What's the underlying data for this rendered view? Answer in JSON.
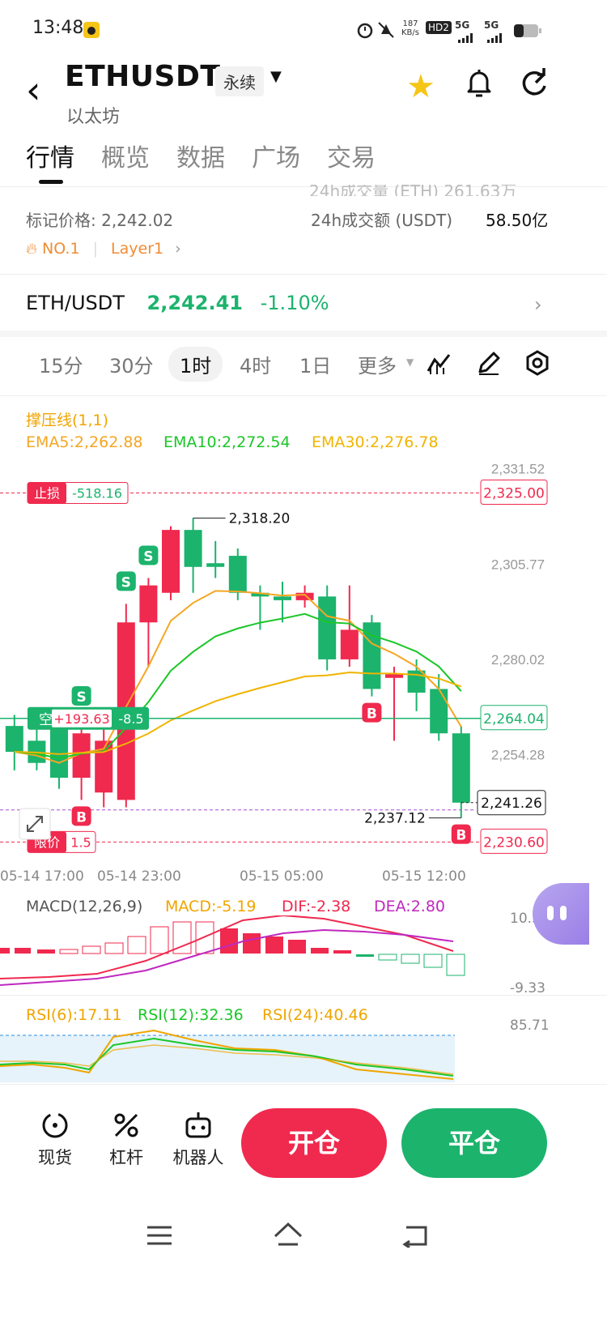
{
  "status_bar": {
    "time": "13:48",
    "net_speed_top": "187",
    "net_speed_bottom": "KB/s",
    "hd": "HD2",
    "sig1": "5G",
    "sig2": "5G"
  },
  "header": {
    "symbol": "ETHUSDT",
    "contract": "永续",
    "name": "以太坊"
  },
  "tabs": [
    "行情",
    "概览",
    "数据",
    "广场",
    "交易"
  ],
  "stats": {
    "mark_price": "标记价格: 2,242.02",
    "turnover_label": "24h成交额 (USDT)",
    "turnover_value": "58.50亿",
    "partial_row": "24h成交量 (ETH)  261.63万"
  },
  "tags": {
    "rank": "NO.1",
    "category": "Layer1"
  },
  "pair": {
    "name": "ETH/USDT",
    "price": "2,242.41",
    "change": "-1.10%"
  },
  "timeframes": [
    "15分",
    "30分",
    "1时",
    "4时",
    "1日",
    "更多"
  ],
  "selected_timeframe": "1时",
  "colors": {
    "up": "#1cb36d",
    "down": "#f0294e",
    "ema5": "#f5a623",
    "ema10": "#1bc628",
    "ema30": "#f0b400",
    "accent": "#f0294e"
  },
  "chart_data": {
    "type": "candlestick",
    "indicator_label": "撑压线(1,1)",
    "ema": {
      "ema5": "EMA5:2,262.88",
      "ema10": "EMA10:2,272.54",
      "ema30": "EMA30:2,276.78"
    },
    "y_ticks": [
      "2,331.52",
      "2,305.77",
      "2,280.02",
      "2,254.28"
    ],
    "x_ticks": [
      "05-14 17:00",
      "05-14 23:00",
      "05-15 05:00",
      "05-15 12:00"
    ],
    "ylim": [
      2225,
      2340
    ],
    "high_label": "2,318.20",
    "low_label": "2,237.12",
    "stop_loss": {
      "label": "止损",
      "pnl": "-518.16",
      "price": "2,325.00",
      "value": 2325
    },
    "position": {
      "label": "空",
      "pnl": "+193.63",
      "qty": "-8.5",
      "price": "2,264.04",
      "value": 2264.04
    },
    "limit": {
      "label": "限价",
      "qty": "1.5",
      "price": "2,230.60",
      "value": 2230.6
    },
    "last_price": {
      "price": "2,241.26",
      "value": 2241.26
    },
    "candles": [
      {
        "o": 2262,
        "c": 2255,
        "h": 2265,
        "l": 2250
      },
      {
        "o": 2258,
        "c": 2252,
        "h": 2262,
        "l": 2250
      },
      {
        "o": 2262,
        "c": 2248,
        "h": 2266,
        "l": 2245
      },
      {
        "o": 2248,
        "c": 2260,
        "h": 2264,
        "l": 2242
      },
      {
        "o": 2244,
        "c": 2258,
        "h": 2262,
        "l": 2240
      },
      {
        "o": 2242,
        "c": 2290,
        "h": 2295,
        "l": 2240
      },
      {
        "o": 2290,
        "c": 2300,
        "h": 2302,
        "l": 2278
      },
      {
        "o": 2298,
        "c": 2315,
        "h": 2316,
        "l": 2296
      },
      {
        "o": 2315,
        "c": 2305,
        "h": 2318.2,
        "l": 2298
      },
      {
        "o": 2306,
        "c": 2305,
        "h": 2312,
        "l": 2302
      },
      {
        "o": 2308,
        "c": 2298,
        "h": 2310,
        "l": 2296
      },
      {
        "o": 2298,
        "c": 2297,
        "h": 2300,
        "l": 2288
      },
      {
        "o": 2297,
        "c": 2296,
        "h": 2301,
        "l": 2290
      },
      {
        "o": 2296,
        "c": 2298,
        "h": 2300,
        "l": 2294
      },
      {
        "o": 2297,
        "c": 2280,
        "h": 2300,
        "l": 2277
      },
      {
        "o": 2280,
        "c": 2288,
        "h": 2300,
        "l": 2278
      },
      {
        "o": 2290,
        "c": 2272,
        "h": 2292,
        "l": 2270
      },
      {
        "o": 2275,
        "c": 2276,
        "h": 2278,
        "l": 2258
      },
      {
        "o": 2277,
        "c": 2271,
        "h": 2280,
        "l": 2266
      },
      {
        "o": 2272,
        "c": 2260,
        "h": 2276,
        "l": 2258
      },
      {
        "o": 2260,
        "c": 2241.26,
        "h": 2262,
        "l": 2237.12
      }
    ],
    "macd": {
      "label": "MACD(12,26,9)",
      "macd": "MACD:-5.19",
      "dif": "DIF:-2.38",
      "dea": "DEA:2.80",
      "ytop": "10.31",
      "ybot": "-9.33"
    },
    "rsi": {
      "rsi6": "RSI(6):17.11",
      "rsi12": "RSI(12):32.36",
      "rsi24": "RSI(24):40.46",
      "ytop": "85.71"
    },
    "markers": [
      {
        "type": "S",
        "index": 6
      },
      {
        "type": "S",
        "index": 5
      },
      {
        "type": "S",
        "index": 3
      },
      {
        "type": "B",
        "index": 3
      },
      {
        "type": "B",
        "index": 16
      },
      {
        "type": "B",
        "index": 20
      }
    ]
  },
  "bottom": {
    "spot": "现货",
    "leverage": "杠杆",
    "robot": "机器人",
    "open": "开仓",
    "close": "平仓"
  }
}
